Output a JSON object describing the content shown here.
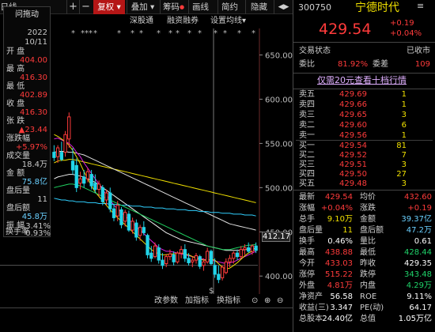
{
  "toolbar": {
    "title": "日线",
    "add_btn": "+",
    "sub_btn": "−",
    "period_label": "复权",
    "overlay_label": "叠加",
    "chips_label": "筹码",
    "draw_label": "画线",
    "simple_label": "简约",
    "hide_label": "隐藏",
    "arrow_label": "◀▶"
  },
  "sub_toolbar": {
    "items": [
      "深股通",
      "融资融券",
      "设置均线"
    ],
    "dropdown_symbol": "▾"
  },
  "info_box": {
    "header": "问拖动",
    "year": "2022",
    "date": "10/11",
    "open_label": "开 盘",
    "open_value": "404.00",
    "high_label": "最 高",
    "high_value": "416.30",
    "low_label": "最 低",
    "low_value": "402.89",
    "close_label": "收 盘",
    "close_value": "416.30",
    "change_label": "张 跌",
    "change_value": "▲23.44",
    "pct_label": "涨跌幅",
    "pct_value": "+5.97%",
    "volume_label": "成交量",
    "volume_value": "18.4万",
    "amount_label": "金 额",
    "amount_value": "75.8亿",
    "after_vol_label": "盘后量",
    "after_vol_value": "11",
    "after_amt_label": "盘后额",
    "after_amt_value": "45.8万",
    "amplitude_label": "振 幅",
    "amplitude_value": "3.41%",
    "turnover_label": "换手率",
    "turnover_value": "0.93%"
  },
  "chart_data": {
    "type": "candlestick",
    "title": "",
    "xlabel": "",
    "ylabel": "",
    "ylim": [
      385,
      680
    ],
    "y_ticks": [
      "650.00",
      "600.00",
      "550.00",
      "500.00",
      "450.00",
      "400.00"
    ],
    "y_tick_values": [
      650,
      600,
      550,
      500,
      450,
      400
    ],
    "current_price_tag": "412.17",
    "low_marker": "402.89",
    "markers": [
      "*",
      "***",
      "*",
      "*",
      "*",
      "*",
      "*",
      "*",
      "*",
      "*",
      "*",
      "*",
      "*",
      "*",
      "*"
    ],
    "candles": [
      {
        "o": 540,
        "h": 548,
        "l": 530,
        "c": 534
      },
      {
        "o": 535,
        "h": 548,
        "l": 528,
        "c": 545
      },
      {
        "o": 540,
        "h": 552,
        "l": 530,
        "c": 532
      },
      {
        "o": 540,
        "h": 564,
        "l": 535,
        "c": 560
      },
      {
        "o": 555,
        "h": 585,
        "l": 545,
        "c": 580
      },
      {
        "o": 530,
        "h": 545,
        "l": 515,
        "c": 520
      },
      {
        "o": 525,
        "h": 533,
        "l": 495,
        "c": 500
      },
      {
        "o": 505,
        "h": 518,
        "l": 498,
        "c": 510
      },
      {
        "o": 512,
        "h": 520,
        "l": 500,
        "c": 505
      },
      {
        "o": 510,
        "h": 522,
        "l": 506,
        "c": 518
      },
      {
        "o": 515,
        "h": 520,
        "l": 498,
        "c": 502
      },
      {
        "o": 505,
        "h": 515,
        "l": 494,
        "c": 498
      },
      {
        "o": 498,
        "h": 508,
        "l": 490,
        "c": 504
      },
      {
        "o": 500,
        "h": 503,
        "l": 480,
        "c": 484
      },
      {
        "o": 486,
        "h": 498,
        "l": 480,
        "c": 494
      },
      {
        "o": 494,
        "h": 500,
        "l": 472,
        "c": 476
      },
      {
        "o": 476,
        "h": 482,
        "l": 462,
        "c": 466
      },
      {
        "o": 468,
        "h": 485,
        "l": 462,
        "c": 480
      },
      {
        "o": 475,
        "h": 478,
        "l": 454,
        "c": 458
      },
      {
        "o": 462,
        "h": 475,
        "l": 456,
        "c": 472
      },
      {
        "o": 470,
        "h": 474,
        "l": 450,
        "c": 452
      },
      {
        "o": 452,
        "h": 466,
        "l": 448,
        "c": 462
      },
      {
        "o": 460,
        "h": 464,
        "l": 440,
        "c": 444
      },
      {
        "o": 446,
        "h": 458,
        "l": 440,
        "c": 455
      },
      {
        "o": 455,
        "h": 462,
        "l": 446,
        "c": 449
      },
      {
        "o": 446,
        "h": 448,
        "l": 420,
        "c": 424
      },
      {
        "o": 426,
        "h": 434,
        "l": 416,
        "c": 420
      },
      {
        "o": 422,
        "h": 438,
        "l": 420,
        "c": 434
      },
      {
        "o": 432,
        "h": 436,
        "l": 414,
        "c": 418
      },
      {
        "o": 418,
        "h": 426,
        "l": 408,
        "c": 412
      },
      {
        "o": 414,
        "h": 425,
        "l": 410,
        "c": 422
      },
      {
        "o": 422,
        "h": 430,
        "l": 418,
        "c": 425
      },
      {
        "o": 424,
        "h": 428,
        "l": 412,
        "c": 416
      },
      {
        "o": 416,
        "h": 428,
        "l": 414,
        "c": 426
      },
      {
        "o": 426,
        "h": 434,
        "l": 420,
        "c": 430
      },
      {
        "o": 430,
        "h": 436,
        "l": 416,
        "c": 420
      },
      {
        "o": 420,
        "h": 426,
        "l": 412,
        "c": 415
      },
      {
        "o": 416,
        "h": 422,
        "l": 410,
        "c": 418
      },
      {
        "o": 418,
        "h": 426,
        "l": 414,
        "c": 423
      },
      {
        "o": 422,
        "h": 424,
        "l": 408,
        "c": 411
      },
      {
        "o": 412,
        "h": 420,
        "l": 406,
        "c": 416
      },
      {
        "o": 416,
        "h": 432,
        "l": 414,
        "c": 428
      },
      {
        "o": 428,
        "h": 430,
        "l": 412,
        "c": 414
      },
      {
        "o": 412,
        "h": 420,
        "l": 398,
        "c": 402
      },
      {
        "o": 402,
        "h": 412,
        "l": 392,
        "c": 396
      },
      {
        "o": 398,
        "h": 412,
        "l": 395,
        "c": 410
      },
      {
        "o": 404,
        "h": 420,
        "l": 402,
        "c": 416
      },
      {
        "o": 416,
        "h": 424,
        "l": 410,
        "c": 420
      },
      {
        "o": 420,
        "h": 428,
        "l": 414,
        "c": 426
      },
      {
        "o": 426,
        "h": 430,
        "l": 418,
        "c": 422
      },
      {
        "o": 422,
        "h": 434,
        "l": 420,
        "c": 430
      },
      {
        "o": 430,
        "h": 436,
        "l": 424,
        "c": 432
      },
      {
        "o": 432,
        "h": 438,
        "l": 426,
        "c": 428
      },
      {
        "o": 428,
        "h": 436,
        "l": 424,
        "c": 434
      },
      {
        "o": 434,
        "h": 438,
        "l": 426,
        "c": 429
      }
    ],
    "ma_lines": [
      {
        "color": "#f0f0f0",
        "values": [
          510,
          512,
          513,
          514,
          515,
          515,
          514,
          513,
          512,
          510,
          508,
          506,
          503,
          500,
          497,
          494,
          491,
          488,
          485,
          482,
          479,
          476,
          473,
          470,
          467,
          464,
          461,
          458,
          455,
          452,
          449,
          447,
          445,
          443,
          441,
          440,
          439,
          438,
          437,
          436,
          435,
          434,
          433,
          432,
          431,
          430,
          429,
          429,
          429,
          429,
          429,
          430,
          430,
          431,
          431
        ]
      },
      {
        "color": "#f0e000",
        "values": [
          528,
          530,
          531,
          531,
          532,
          532,
          531,
          530,
          529,
          528,
          527,
          526,
          525,
          524,
          523,
          522,
          521,
          520,
          519,
          518,
          517,
          516,
          515,
          514,
          513,
          512,
          511,
          510,
          509,
          508,
          507,
          506,
          505,
          504,
          503,
          502,
          501,
          500,
          499,
          498,
          497,
          496,
          495,
          494,
          493,
          492,
          491,
          490,
          489,
          488,
          487,
          486,
          485,
          484,
          483
        ]
      },
      {
        "color": "#e0e0e0",
        "values": [
          540,
          541,
          541,
          541,
          540,
          540,
          539,
          538,
          537,
          535,
          533,
          531,
          529,
          527,
          525,
          523,
          521,
          519,
          517,
          515,
          513,
          511,
          509,
          507,
          505,
          503,
          501,
          499,
          497,
          495,
          493,
          491,
          489,
          487,
          485,
          483,
          481,
          479,
          477,
          475,
          473,
          471,
          469,
          467,
          465,
          463,
          461,
          459,
          458,
          457,
          456,
          455,
          454,
          453,
          452
        ]
      },
      {
        "color": "#e020e0",
        "values": [
          555,
          556,
          554,
          552,
          550,
          546,
          540,
          535,
          528,
          522,
          516,
          510,
          504,
          498,
          492,
          486,
          480,
          476,
          472,
          468,
          464,
          460,
          456,
          452,
          448,
          444,
          440,
          436,
          432,
          430,
          428,
          428,
          427,
          426,
          425,
          424,
          423,
          422,
          421,
          420,
          419,
          418,
          418,
          417,
          416,
          415,
          414,
          415,
          416,
          418,
          420,
          422,
          424,
          426,
          428
        ]
      },
      {
        "color": "#f0e000",
        "values": [
          560,
          558,
          555,
          552,
          548,
          542,
          535,
          527,
          518,
          510,
          502,
          495,
          490,
          485,
          480,
          475,
          470,
          466,
          462,
          458,
          454,
          450,
          446,
          442,
          438,
          434,
          430,
          427,
          425,
          424,
          424,
          425,
          425,
          426,
          426,
          425,
          424,
          422,
          420,
          419,
          418,
          418,
          419,
          418,
          414,
          410,
          408,
          409,
          412,
          415,
          419,
          423,
          426,
          428,
          430
        ]
      },
      {
        "color": "#30d0ff",
        "values": [
          488,
          487,
          486,
          486,
          485,
          485,
          484,
          484,
          484,
          483,
          483,
          483,
          482,
          482,
          482,
          481,
          481,
          481,
          480,
          480,
          480,
          479,
          479,
          479,
          478,
          478,
          478,
          477,
          477,
          477,
          476,
          476,
          476,
          475,
          475,
          475,
          474,
          474,
          474,
          473,
          473,
          473,
          472,
          472,
          472,
          471,
          471,
          471,
          470,
          470,
          470,
          469,
          469,
          469,
          468
        ]
      },
      {
        "color": "#20d060",
        "values": [
          500,
          501,
          502,
          503,
          504,
          504,
          503,
          502,
          500,
          498,
          496,
          494,
          492,
          490,
          488,
          486,
          484,
          482,
          480,
          478,
          476,
          474,
          472,
          470,
          468,
          466,
          464,
          462,
          460,
          458,
          456,
          454,
          452,
          450,
          448,
          446,
          444,
          442,
          440,
          438,
          436,
          434,
          433,
          432,
          431,
          430,
          430,
          430,
          431,
          432,
          433,
          434,
          435,
          435,
          436
        ]
      }
    ],
    "colors": {
      "up": "#ff3b3b",
      "down": "#22d4e8",
      "grid": "#2a2a2a",
      "axis": "#6b2a2a"
    }
  },
  "bottom_toolbar": {
    "items": [
      "改参数",
      "加指标",
      "换指标"
    ],
    "zoom_in": "⊕",
    "zoom_out": "⊖",
    "settings_symbol": "⊙"
  },
  "quote": {
    "code": "300750",
    "name": "宁德时代",
    "price": "429.54",
    "change": "+0.19",
    "change_pct": "+0.04%",
    "status_label": "交易状态",
    "status_value": "已收市",
    "ratio_label": "委比",
    "ratio_value": "81.92%",
    "diff_label": "委差",
    "diff_value": "109",
    "banner": "仅需20元查看十档行情",
    "asks": [
      {
        "label": "卖五",
        "price": "429.69",
        "vol": "1"
      },
      {
        "label": "卖四",
        "price": "429.66",
        "vol": "1"
      },
      {
        "label": "卖三",
        "price": "429.65",
        "vol": "3"
      },
      {
        "label": "卖二",
        "price": "429.60",
        "vol": "6"
      },
      {
        "label": "卖一",
        "price": "429.56",
        "vol": "1"
      }
    ],
    "bids": [
      {
        "label": "买一",
        "price": "429.54",
        "vol": "81"
      },
      {
        "label": "买二",
        "price": "429.52",
        "vol": "7"
      },
      {
        "label": "买三",
        "price": "429.51",
        "vol": "3"
      },
      {
        "label": "买四",
        "price": "429.50",
        "vol": "27"
      },
      {
        "label": "买五",
        "price": "429.48",
        "vol": "3"
      }
    ],
    "stats": [
      {
        "l1": "最新",
        "v1": "429.54",
        "c1": "red",
        "l2": "均价",
        "v2": "432.60",
        "c2": "red"
      },
      {
        "l1": "涨幅",
        "v1": "+0.04%",
        "c1": "red",
        "l2": "涨跌",
        "v2": "+0.19",
        "c2": "red"
      },
      {
        "l1": "总手",
        "v1": "9.10万",
        "c1": "yellow",
        "l2": "金额",
        "v2": "39.37亿",
        "c2": "cyan"
      },
      {
        "l1": "盘后量",
        "v1": "11",
        "c1": "yellow",
        "l2": "盘后额",
        "v2": "47.2万",
        "c2": "cyan"
      },
      {
        "l1": "换手",
        "v1": "0.46%",
        "c1": "white",
        "l2": "量比",
        "v2": "0.61",
        "c2": "white"
      },
      {
        "l1": "最高",
        "v1": "438.88",
        "c1": "red",
        "l2": "最低",
        "v2": "428.44",
        "c2": "green"
      },
      {
        "l1": "今开",
        "v1": "433.03",
        "c1": "red",
        "l2": "昨收",
        "v2": "429.35",
        "c2": "white"
      },
      {
        "l1": "涨停",
        "v1": "515.22",
        "c1": "red",
        "l2": "跌停",
        "v2": "343.48",
        "c2": "green"
      },
      {
        "l1": "外盘",
        "v1": "4.81万",
        "c1": "red",
        "l2": "内盘",
        "v2": "4.29万",
        "c2": "green"
      },
      {
        "l1": "净资产",
        "v1": "56.58",
        "c1": "white",
        "l2": "ROE",
        "v2": "9.11%",
        "c2": "white"
      },
      {
        "l1": "收益(三)",
        "v1": "3.347",
        "c1": "white",
        "l2": "PE(动)",
        "v2": "64.17",
        "c2": "white"
      },
      {
        "l1": "总股本",
        "v1": "24.40亿",
        "c1": "white",
        "l2": "总值",
        "v2": "1.05万亿",
        "c2": "white"
      }
    ]
  }
}
